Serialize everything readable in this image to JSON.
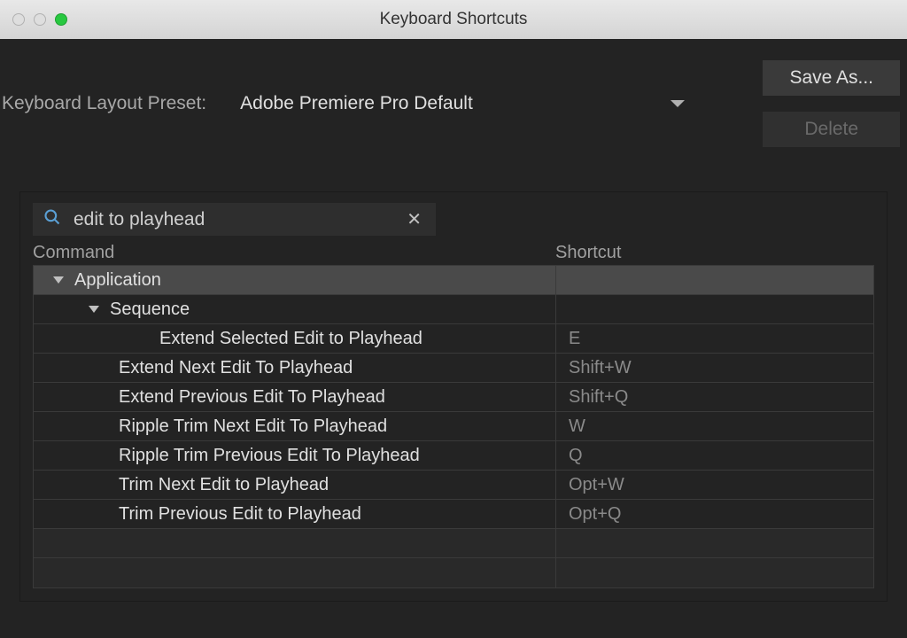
{
  "window": {
    "title": "Keyboard Shortcuts"
  },
  "preset": {
    "label": "Keyboard Layout Preset:",
    "value": "Adobe Premiere Pro Default"
  },
  "buttons": {
    "save_as": "Save As...",
    "delete": "Delete"
  },
  "search": {
    "value": "edit to playhead"
  },
  "columns": {
    "command": "Command",
    "shortcut": "Shortcut"
  },
  "tree": {
    "application": {
      "label": "Application",
      "sequence": {
        "label": "Sequence",
        "items": [
          {
            "command": "Extend Selected Edit to Playhead",
            "shortcut": "E",
            "deep": true
          },
          {
            "command": "Extend Next Edit To Playhead",
            "shortcut": "Shift+W"
          },
          {
            "command": "Extend Previous Edit To Playhead",
            "shortcut": "Shift+Q"
          },
          {
            "command": "Ripple Trim Next Edit To Playhead",
            "shortcut": "W"
          },
          {
            "command": "Ripple Trim Previous Edit To Playhead",
            "shortcut": "Q"
          },
          {
            "command": "Trim Next Edit to Playhead",
            "shortcut": "Opt+W"
          },
          {
            "command": "Trim Previous Edit to Playhead",
            "shortcut": "Opt+Q"
          }
        ]
      }
    }
  }
}
